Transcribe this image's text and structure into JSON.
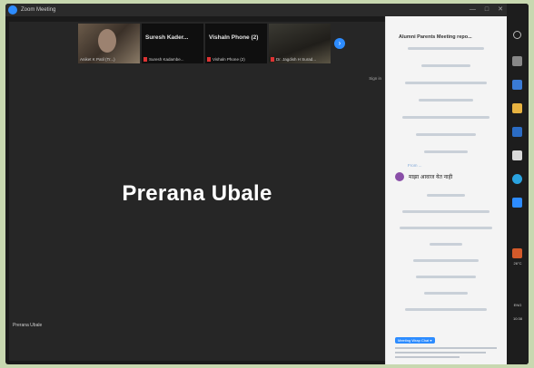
{
  "window": {
    "title": "Zoom Meeting"
  },
  "thumbnails": [
    {
      "big_name": "",
      "small_name": "Aniket K Patil (Tr...)"
    },
    {
      "big_name": "Suresh Kader...",
      "small_name": "Suresh Kadambe..."
    },
    {
      "big_name": "Vishaln Phone (2)",
      "small_name": "Vishaln Phone (2)"
    },
    {
      "big_name": "",
      "small_name": "Dr. Jagdish H Surad..."
    }
  ],
  "main": {
    "speaker_name": "Prerana Ubale",
    "corner_name": "Prerana Ubale",
    "sign_in": "Sign in"
  },
  "chat": {
    "title": "Alumni Parents Meeting repo...",
    "sender": "From ...",
    "message": "माझा आवाज येत नाही",
    "badge": "Meeting Wrap Chat ▾"
  },
  "taskbar": {
    "temp": "26°C",
    "lang": "ENG",
    "time": "10:38"
  },
  "colors": {
    "accent": "#2d8cff",
    "chat_bg": "#f4f4f4",
    "video_bg": "#262626"
  },
  "icons": [
    "zoom-logo-icon",
    "next-page-arrow-icon",
    "mic-muted-icon",
    "search-icon",
    "chrome-icon",
    "edge-icon"
  ]
}
